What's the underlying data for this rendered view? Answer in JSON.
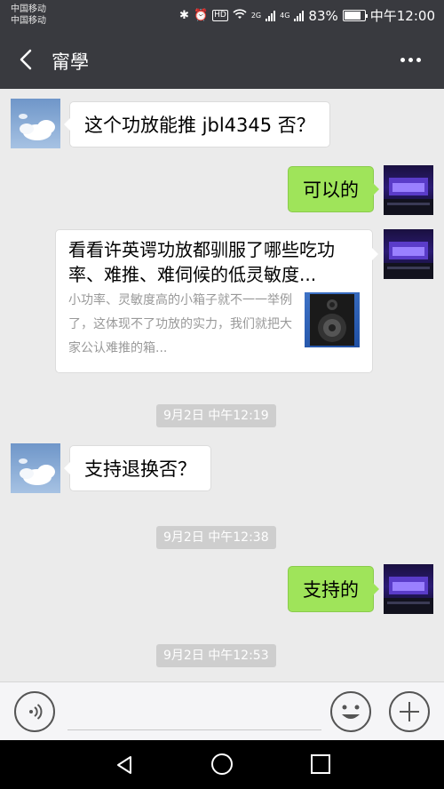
{
  "status_bar": {
    "carrier_1": "中国移动",
    "carrier_2": "中国移动",
    "network_2g": "2G",
    "network_4g": "4G",
    "battery": "83%",
    "time": "中午12:00"
  },
  "header": {
    "title": "甯學"
  },
  "messages": [
    {
      "direction": "incoming",
      "text": "这个功放能推 jbl4345 否？"
    },
    {
      "direction": "outgoing",
      "text": "可以的"
    },
    {
      "direction": "outgoing",
      "type": "link-card",
      "title": "看看许英谔功放都驯服了哪些吃功率、难推、难伺候的低灵敏度...",
      "description": "小功率、灵敏度高的小箱子就不一一举例了，这体现不了功放的实力，我们就把大家公认难推的箱..."
    },
    {
      "type": "timestamp",
      "text": "9月2日 中午12:19"
    },
    {
      "direction": "incoming",
      "text": "支持退换否？"
    },
    {
      "type": "timestamp",
      "text": "9月2日 中午12:38"
    },
    {
      "direction": "outgoing",
      "text": "支持的"
    },
    {
      "type": "timestamp",
      "text": "9月2日 中午12:53"
    }
  ],
  "colors": {
    "header_bg": "#393a3f",
    "chat_bg": "#ebebeb",
    "outgoing_bubble": "#9fe45a",
    "incoming_bubble": "#ffffff",
    "timestamp_bg": "#cecece"
  }
}
